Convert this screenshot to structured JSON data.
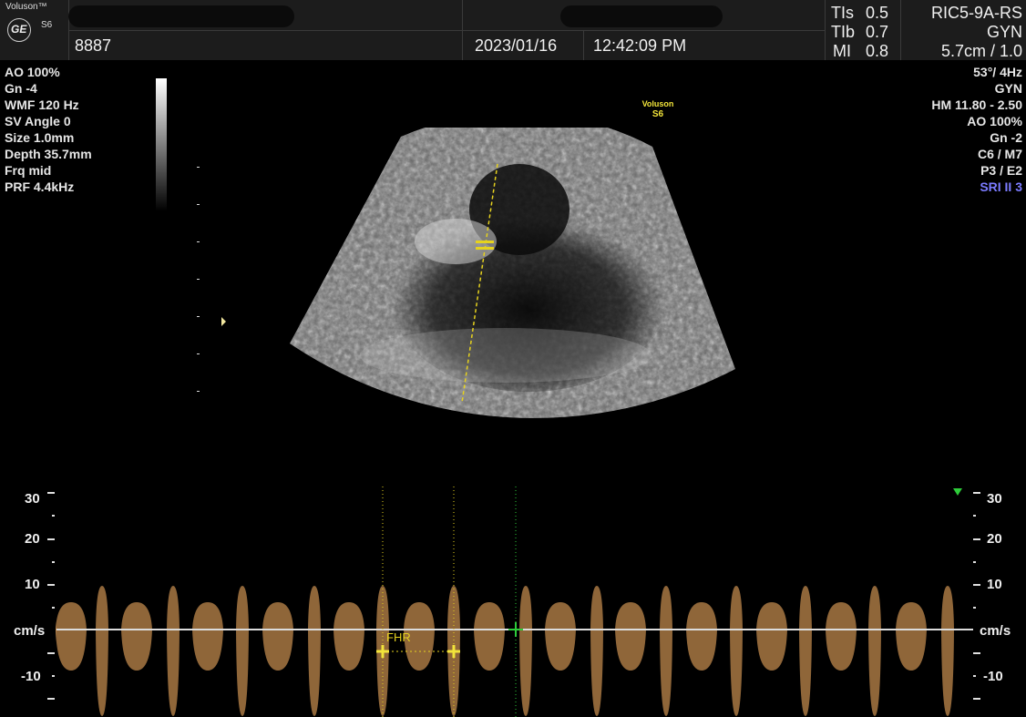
{
  "header": {
    "logo_brand": "Voluson™",
    "logo_model": "S6",
    "logo_emblem": "GE",
    "patient_id": "8887",
    "date": "2023/01/16",
    "time": "12:42:09 PM",
    "tis_label": "TIs",
    "tis_value": "0.5",
    "tib_label": "TIb",
    "tib_value": "0.7",
    "mi_label": "MI",
    "mi_value": "0.8",
    "probe": "RIC5-9A-RS",
    "preset": "GYN",
    "depth_zoom": "5.7cm / 1.0"
  },
  "left_params": [
    "AO 100%",
    "Gn  -4",
    "WMF 120 Hz",
    "SV Angle  0",
    "Size  1.0mm",
    "Depth 35.7mm",
    "Frq mid",
    "PRF  4.4kHz"
  ],
  "right_params": [
    "53°/  4Hz",
    "GYN",
    "HM  11.80 - 2.50",
    "AO 100%",
    "Gn  -2",
    "C6 / M7",
    "P3 / E2",
    "SRI II 3"
  ],
  "watermark": {
    "brand": "Voluson",
    "model": "S6"
  },
  "doppler": {
    "scale_labels": [
      "30",
      "20",
      "10",
      "cm/s",
      "-10"
    ],
    "measurement_label": "FHR"
  },
  "colors": {
    "header_bg": "#1c1c1c",
    "doppler_spectrum": "#e0a05a",
    "caliper": "#e6d21e",
    "marker_green": "#2ecc3a",
    "sri_text": "#7b7bff"
  }
}
